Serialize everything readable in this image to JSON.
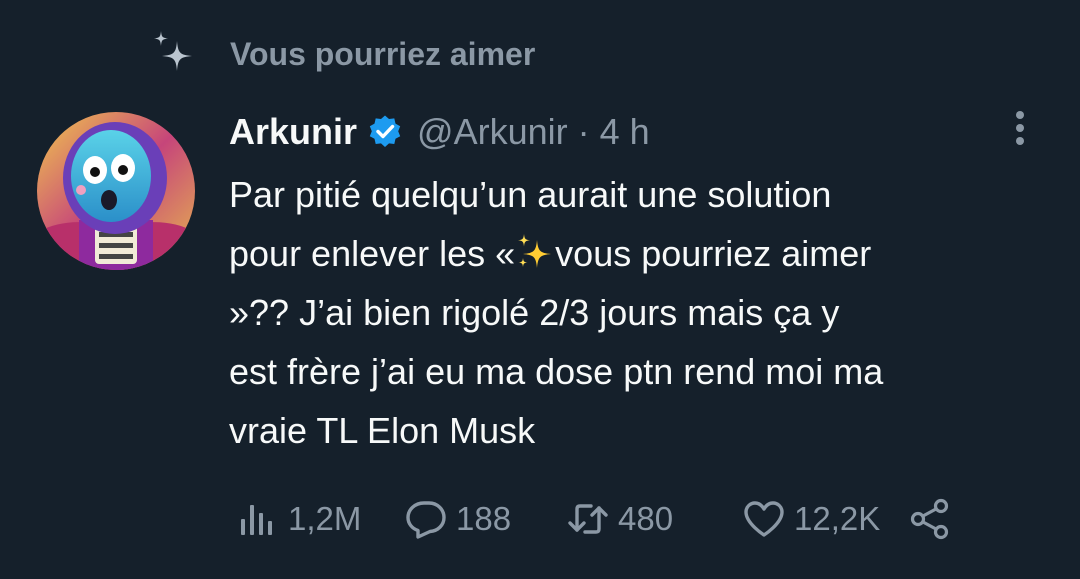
{
  "context": {
    "label": "Vous pourriez aimer",
    "icon": "sparkle-icon"
  },
  "tweet": {
    "author": {
      "display_name": "Arkunir",
      "verified": true,
      "handle": "@Arkunir",
      "avatar": "avatar"
    },
    "separator": "·",
    "time": "4 h",
    "text_lines": [
      [
        "Par pitié quelqu’un aurait une solution"
      ],
      [
        "pour enlever les «",
        "vous pourriez aimer"
      ],
      [
        "»?? J’ai bien rigolé 2/3 jours mais ça y"
      ],
      [
        "est frère j’ai eu ma dose ptn rend moi ma"
      ],
      [
        "vraie TL Elon Musk"
      ]
    ],
    "inline_emoji": "sparkles-emoji"
  },
  "actions": {
    "views": {
      "icon": "views-icon",
      "count": "1,2M"
    },
    "replies": {
      "icon": "reply-icon",
      "count": "188"
    },
    "retweets": {
      "icon": "retweet-icon",
      "count": "480"
    },
    "likes": {
      "icon": "heart-icon",
      "count": "12,2K"
    },
    "share": {
      "icon": "share-icon"
    }
  },
  "colors": {
    "background": "#15202b",
    "text_primary": "#f7f9f9",
    "text_secondary": "#8b98a5",
    "verified": "#1d9bf0",
    "sparkle": "#ffcc33"
  }
}
